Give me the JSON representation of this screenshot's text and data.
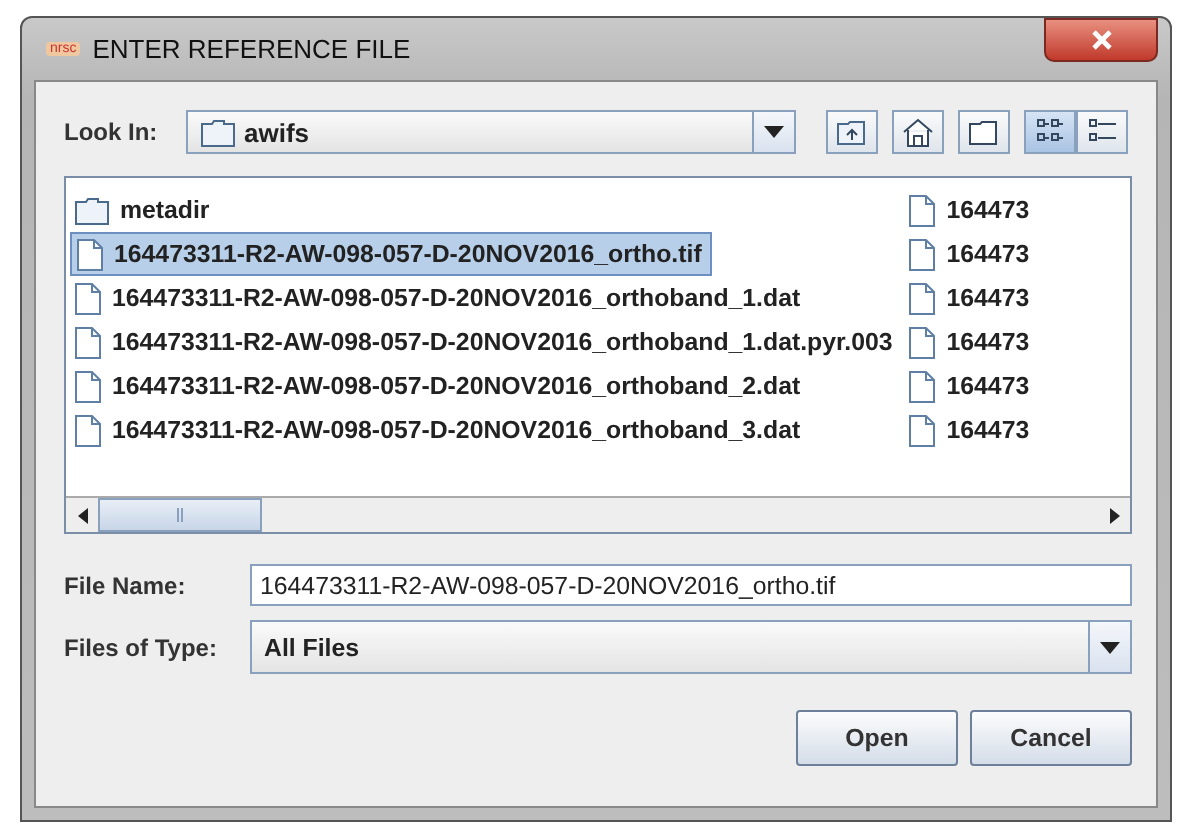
{
  "window": {
    "app_icon_text": "nrsc",
    "title": "ENTER REFERENCE FILE"
  },
  "look_in": {
    "label": "Look In:",
    "value": "awifs"
  },
  "toolbar": [
    {
      "kind": "up"
    },
    {
      "kind": "home"
    },
    {
      "kind": "new-folder"
    },
    {
      "kind": "list",
      "selected": true
    },
    {
      "kind": "details",
      "selected": false
    }
  ],
  "files": {
    "column_1": [
      {
        "kind": "folder",
        "name": "metadir",
        "selected": false
      },
      {
        "kind": "file",
        "name": "164473311-R2-AW-098-057-D-20NOV2016_ortho.tif",
        "selected": true
      },
      {
        "kind": "file",
        "name": "164473311-R2-AW-098-057-D-20NOV2016_orthoband_1.dat",
        "selected": false
      },
      {
        "kind": "file",
        "name": "164473311-R2-AW-098-057-D-20NOV2016_orthoband_1.dat.pyr.003",
        "selected": false
      },
      {
        "kind": "file",
        "name": "164473311-R2-AW-098-057-D-20NOV2016_orthoband_2.dat",
        "selected": false
      },
      {
        "kind": "file",
        "name": "164473311-R2-AW-098-057-D-20NOV2016_orthoband_3.dat",
        "selected": false
      }
    ],
    "column_2": [
      {
        "kind": "file",
        "name": "164473",
        "selected": false
      },
      {
        "kind": "file",
        "name": "164473",
        "selected": false
      },
      {
        "kind": "file",
        "name": "164473",
        "selected": false
      },
      {
        "kind": "file",
        "name": "164473",
        "selected": false
      },
      {
        "kind": "file",
        "name": "164473",
        "selected": false
      },
      {
        "kind": "file",
        "name": "164473",
        "selected": false
      }
    ]
  },
  "file_name": {
    "label": "File Name:",
    "value": "164473311-R2-AW-098-057-D-20NOV2016_ortho.tif"
  },
  "file_type": {
    "label": "Files of Type:",
    "value": "All Files"
  },
  "buttons": [
    "Open",
    "Cancel"
  ]
}
